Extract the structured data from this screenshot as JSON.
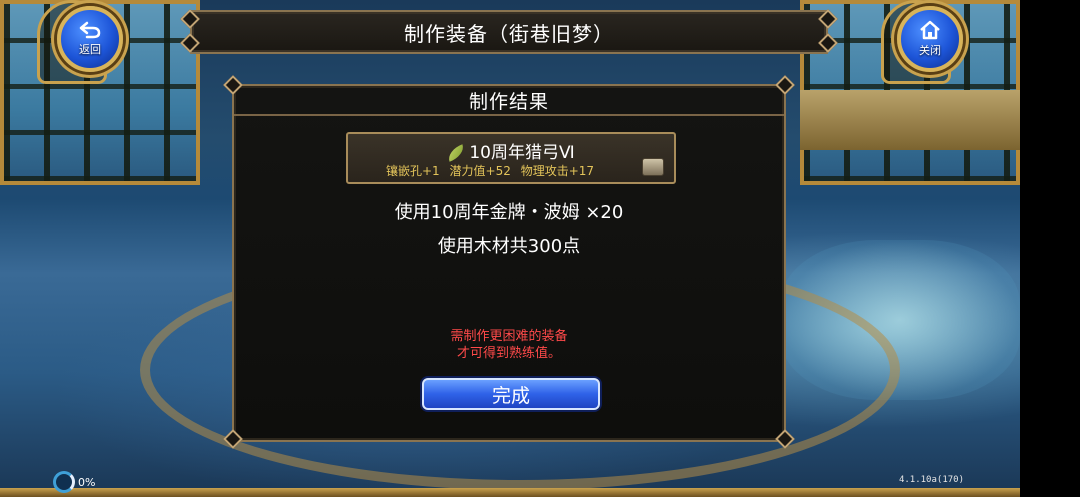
{
  "nav": {
    "back_label": "返回",
    "close_label": "关闭"
  },
  "title": "制作装备（街巷旧梦）",
  "panel": {
    "header": "制作结果",
    "item": {
      "icon": "leaf-icon",
      "name": "10周年猎弓Ⅵ",
      "stats": [
        "镶嵌孔+1",
        "潜力值+52",
        "物理攻击+17"
      ],
      "extra_icon": "chest-icon"
    },
    "use_medal": "使用10周年金牌・波姆 ×20",
    "use_wood": "使用木材共300点",
    "warning_line1": "需制作更困难的装备",
    "warning_line2": "才可得到熟练值。",
    "done_button": "完成"
  },
  "status": {
    "load_percent": "0%",
    "version": "4.1.10a(170)"
  },
  "colors": {
    "warning": "#ff4a4a",
    "stats": "#e3c45a",
    "button": "#2f62e8",
    "frame": "#8a7450"
  }
}
